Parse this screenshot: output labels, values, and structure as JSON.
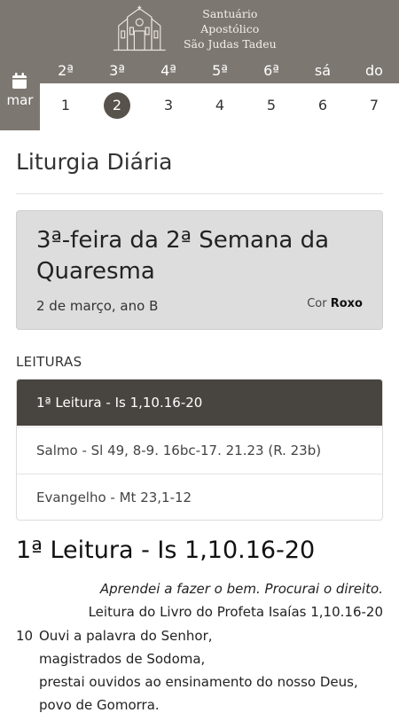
{
  "header": {
    "logo_line1": "Santuário Apostólico",
    "logo_line2": "São Judas Tadeu",
    "bar_color": "#7d7771"
  },
  "calendar": {
    "month": "mar",
    "weekdays": [
      "2ª",
      "3ª",
      "4ª",
      "5ª",
      "6ª",
      "sá",
      "do"
    ],
    "days": [
      "1",
      "2",
      "3",
      "4",
      "5",
      "6",
      "7"
    ],
    "selected_day": "2"
  },
  "page": {
    "title": "Liturgia Diária"
  },
  "day_card": {
    "title": "3ª-feira da 2ª Semana da Quaresma",
    "date": "2 de março, ano B",
    "color_label": "Cor",
    "color_value": "Roxo"
  },
  "readings": {
    "label": "LEITURAS",
    "items": [
      {
        "label": "1ª Leitura - Is 1,10.16-20",
        "active": true
      },
      {
        "label": "Salmo - Sl 49, 8-9. 16bc-17. 21.23 (R. 23b)",
        "active": false
      },
      {
        "label": "Evangelho - Mt 23,1-12",
        "active": false
      }
    ]
  },
  "reading": {
    "heading": "1ª Leitura - Is 1,10.16-20",
    "antiphon": "Aprendei a fazer o bem. Procurai o direito.",
    "book_ref": "Leitura do Livro do Profeta Isaías 1,10.16-20",
    "verse_number": "10",
    "lines": [
      "Ouvi a palavra do Senhor,",
      "magistrados de Sodoma,",
      "prestai ouvidos ao ensinamento do nosso Deus,",
      "povo de Gomorra."
    ]
  }
}
